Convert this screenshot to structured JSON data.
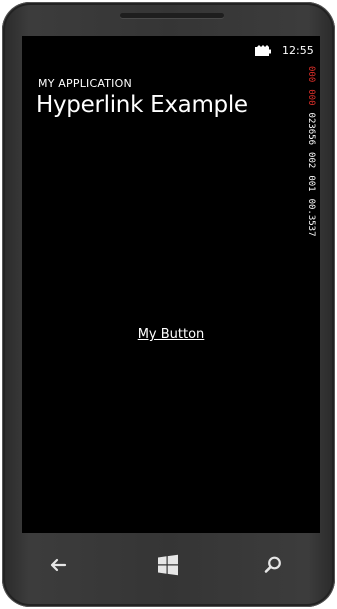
{
  "status_bar": {
    "time": "12:55",
    "battery_icon": "battery-charging-icon"
  },
  "header": {
    "app_title": "MY APPLICATION",
    "page_title": "Hyperlink Example"
  },
  "main": {
    "hyperlink_label": "My Button"
  },
  "frame_counter": {
    "segments": [
      {
        "text": "000",
        "color": "#e0302a"
      },
      {
        "text": "000",
        "color": "#e0302a"
      },
      {
        "text": "023656",
        "color": "#ffffff"
      },
      {
        "text": "002",
        "color": "#ffffff"
      },
      {
        "text": "001",
        "color": "#ffffff"
      },
      {
        "text": "00.3537",
        "color": "#ffffff"
      }
    ]
  },
  "nav_bar": {
    "back_icon": "back-arrow-icon",
    "start_icon": "windows-logo-icon",
    "search_icon": "search-icon"
  },
  "colors": {
    "screen_bg": "#000000",
    "text": "#ffffff",
    "counter_red": "#e0302a",
    "phone_body": "#353535"
  }
}
